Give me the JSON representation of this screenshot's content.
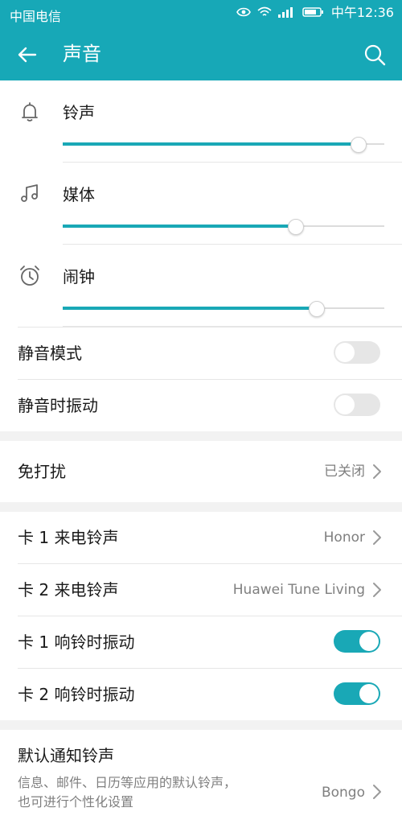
{
  "status_bar": {
    "carrier": "中国电信",
    "time": "中午12:36",
    "icons": [
      "eye-icon",
      "wifi-icon",
      "4g-signal-icon",
      "battery-icon"
    ]
  },
  "app_bar": {
    "title": "声音",
    "back_icon": "arrow-left-icon",
    "search_icon": "search-icon"
  },
  "volumes": [
    {
      "label": "铃声",
      "icon": "bell-icon",
      "level": 0.92
    },
    {
      "label": "媒体",
      "icon": "music-note-icon",
      "level": 0.725
    },
    {
      "label": "闹钟",
      "icon": "alarm-icon",
      "level": 0.79
    }
  ],
  "settings": {
    "silent_mode": {
      "label": "静音模式",
      "on": false
    },
    "silent_vibration": {
      "label": "静音时振动",
      "on": false
    },
    "dnd": {
      "label": "免打扰",
      "value": "已关闭"
    },
    "sim1_ringtone": {
      "label": "卡 1 来电铃声",
      "value": "Honor"
    },
    "sim2_ringtone": {
      "label": "卡 2 来电铃声",
      "value": "Huawei Tune Living"
    },
    "sim1_vibrate": {
      "label": "卡 1 响铃时振动",
      "on": true
    },
    "sim2_vibrate": {
      "label": "卡 2 响铃时振动",
      "on": true
    },
    "notification": {
      "label": "默认通知铃声",
      "description": "信息、邮件、日历等应用的默认铃声，也可进行个性化设置",
      "value": "Bongo"
    }
  },
  "colors": {
    "accent": "#19a8b6",
    "header": "#17a8b7",
    "background": "#f2f2f2",
    "card": "#ffffff",
    "secondary_text": "#7f7f7f"
  }
}
